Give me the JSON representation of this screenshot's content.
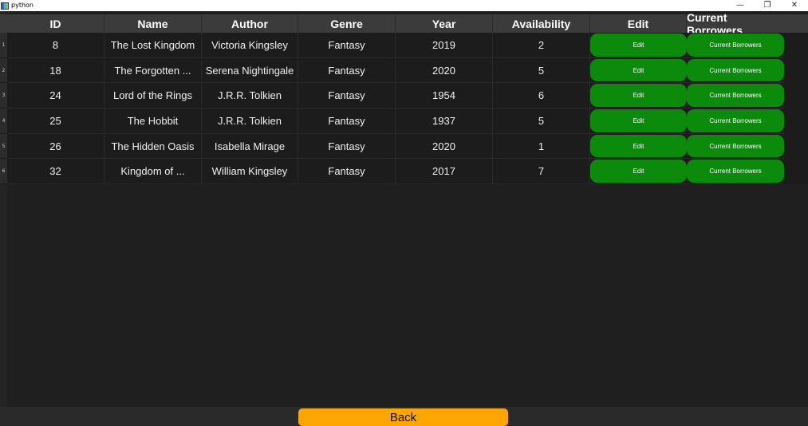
{
  "window": {
    "title": "python",
    "controls": {
      "minimize": "—",
      "restore": "❐",
      "close": "✕"
    }
  },
  "table": {
    "columns": [
      "ID",
      "Name",
      "Author",
      "Genre",
      "Year",
      "Availability",
      "Edit",
      "Current Borrowers"
    ],
    "rows": [
      {
        "num": "1",
        "id": "8",
        "name": "The Lost Kingdom",
        "author": "Victoria Kingsley",
        "genre": "Fantasy",
        "year": "2019",
        "availability": "2",
        "edit": "Edit",
        "borrowers": "Current Borrowers"
      },
      {
        "num": "2",
        "id": "18",
        "name": "The Forgotten ...",
        "author": "Serena Nightingale",
        "genre": "Fantasy",
        "year": "2020",
        "availability": "5",
        "edit": "Edit",
        "borrowers": "Current Borrowers"
      },
      {
        "num": "3",
        "id": "24",
        "name": "Lord of the Rings",
        "author": "J.R.R. Tolkien",
        "genre": "Fantasy",
        "year": "1954",
        "availability": "6",
        "edit": "Edit",
        "borrowers": "Current Borrowers"
      },
      {
        "num": "4",
        "id": "25",
        "name": "The Hobbit",
        "author": "J.R.R. Tolkien",
        "genre": "Fantasy",
        "year": "1937",
        "availability": "5",
        "edit": "Edit",
        "borrowers": "Current Borrowers"
      },
      {
        "num": "5",
        "id": "26",
        "name": "The Hidden Oasis",
        "author": "Isabella Mirage",
        "genre": "Fantasy",
        "year": "2020",
        "availability": "1",
        "edit": "Edit",
        "borrowers": "Current Borrowers"
      },
      {
        "num": "6",
        "id": "32",
        "name": "Kingdom of ...",
        "author": "William Kingsley",
        "genre": "Fantasy",
        "year": "2017",
        "availability": "7",
        "edit": "Edit",
        "borrowers": "Current Borrowers"
      }
    ]
  },
  "back_button": {
    "label": "Back"
  },
  "colors": {
    "button_green": "#0b8a0b",
    "back_orange": "#ffa500",
    "header_bg": "#3b3b3b",
    "table_bg": "#1c1c1c"
  }
}
